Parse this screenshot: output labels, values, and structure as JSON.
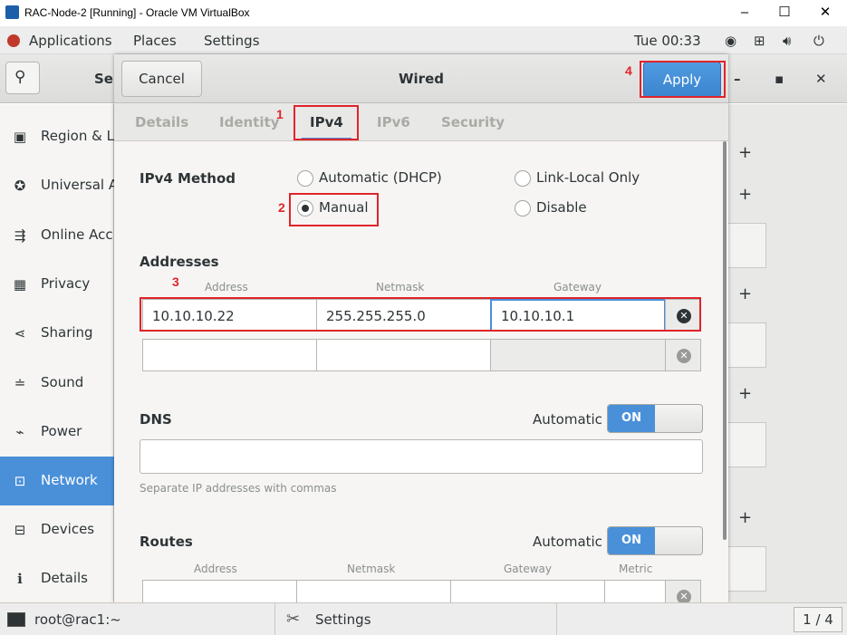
{
  "host_window": {
    "title": "RAC-Node-2 [Running] - Oracle VM VirtualBox",
    "minimize": "–",
    "maximize": "☐",
    "close": "✕"
  },
  "topbar": {
    "applications": "Applications",
    "places": "Places",
    "settings": "Settings",
    "clock": "Tue 00:33"
  },
  "settings_window": {
    "title_fragment": "Se",
    "sidebar": [
      {
        "label": "Region & L",
        "icon": "region-icon",
        "glyph": "▣"
      },
      {
        "label": "Universal A",
        "icon": "universal-access-icon",
        "glyph": "✪"
      },
      {
        "label": "Online Acc",
        "icon": "online-accounts-icon",
        "glyph": "⇶"
      },
      {
        "label": "Privacy",
        "icon": "privacy-icon",
        "glyph": "▦"
      },
      {
        "label": "Sharing",
        "icon": "sharing-icon",
        "glyph": "⋖"
      },
      {
        "label": "Sound",
        "icon": "sound-icon",
        "glyph": "≐"
      },
      {
        "label": "Power",
        "icon": "power-icon",
        "glyph": "⌁"
      },
      {
        "label": "Network",
        "icon": "network-icon",
        "glyph": "⊡"
      },
      {
        "label": "Devices",
        "icon": "devices-icon",
        "glyph": "⊟"
      },
      {
        "label": "Details",
        "icon": "details-icon",
        "glyph": "ℹ"
      }
    ],
    "plus": "+",
    "win_min": "–",
    "win_max": "▪",
    "win_close": "✕"
  },
  "dialog": {
    "title": "Wired",
    "cancel": "Cancel",
    "apply": "Apply",
    "tabs": [
      "Details",
      "Identity",
      "IPv4",
      "IPv6",
      "Security"
    ],
    "ipv4_method_label": "IPv4 Method",
    "methods": {
      "automatic": "Automatic (DHCP)",
      "link_local": "Link-Local Only",
      "manual": "Manual",
      "disable": "Disable"
    },
    "selected_method": "Manual",
    "addresses": {
      "heading": "Addresses",
      "col_address": "Address",
      "col_netmask": "Netmask",
      "col_gateway": "Gateway",
      "rows": [
        {
          "address": "10.10.10.22",
          "netmask": "255.255.255.0",
          "gateway": "10.10.10.1"
        },
        {
          "address": "",
          "netmask": "",
          "gateway": ""
        }
      ]
    },
    "dns": {
      "heading": "DNS",
      "automatic_label": "Automatic",
      "switch": "ON",
      "value": "",
      "hint": "Separate IP addresses with commas"
    },
    "routes": {
      "heading": "Routes",
      "automatic_label": "Automatic",
      "switch": "ON",
      "col_address": "Address",
      "col_netmask": "Netmask",
      "col_gateway": "Gateway",
      "col_metric": "Metric"
    }
  },
  "annotations": {
    "a1": "1",
    "a2": "2",
    "a3": "3",
    "a4": "4"
  },
  "taskbar": {
    "terminal": "root@rac1:~",
    "settings": "Settings",
    "workspace": "1 / 4"
  },
  "colors": {
    "accent": "#4a90d9",
    "annotation": "#e0242a",
    "selected_sidebar": "#4a90d9"
  }
}
